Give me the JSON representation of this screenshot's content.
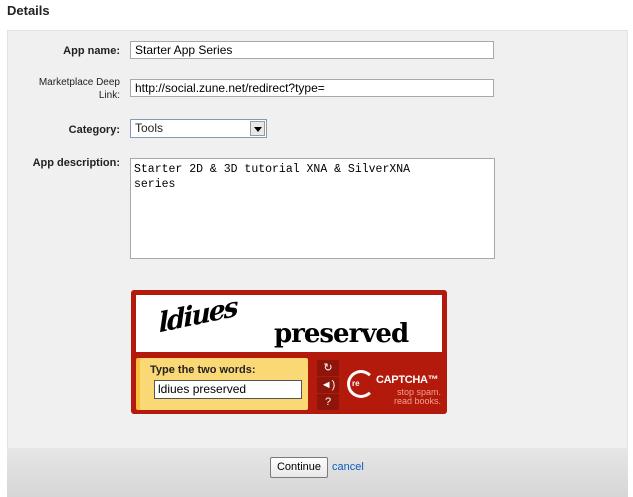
{
  "section": {
    "title": "Details"
  },
  "form": {
    "app_name": {
      "label": "App name:",
      "value": "Starter App Series"
    },
    "deep_link": {
      "label_line1": "Marketplace Deep",
      "label_line2": "Link:",
      "value": "http://social.zune.net/redirect?type="
    },
    "category": {
      "label": "Category:",
      "selected": "Tools"
    },
    "description": {
      "label": "App description:",
      "value": "Starter 2D & 3D tutorial XNA & SilverXNA\nseries"
    }
  },
  "captcha": {
    "word1": "ldiues",
    "word2": "preserved",
    "prompt": "Type the two words:",
    "response": "ldiues preserved",
    "reload_icon": "reload-icon",
    "audio_icon": "speaker-icon",
    "help_icon": "help-icon",
    "brand_re": "re",
    "brand_name": "CAPTCHA™",
    "tagline_1": "stop spam.",
    "tagline_2": "read books.",
    "colors": {
      "frame": "#b31a0c",
      "prompt_bg": "#fbd876"
    }
  },
  "footer": {
    "continue_label": "Continue",
    "cancel_label": "cancel"
  }
}
